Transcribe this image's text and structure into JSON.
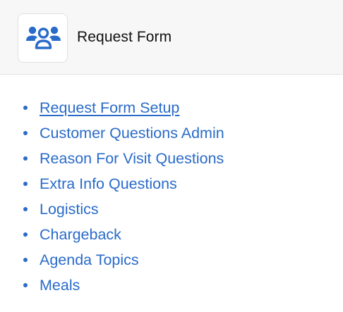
{
  "header": {
    "title": "Request Form",
    "icon": "users-group-icon",
    "accent_color": "#2a6bc9"
  },
  "nav": {
    "items": [
      {
        "label": "Request Form Setup",
        "underlined": true
      },
      {
        "label": "Customer Questions Admin"
      },
      {
        "label": "Reason For Visit Questions"
      },
      {
        "label": "Extra Info Questions"
      },
      {
        "label": "Logistics"
      },
      {
        "label": "Chargeback"
      },
      {
        "label": "Agenda Topics"
      },
      {
        "label": "Meals"
      }
    ]
  }
}
